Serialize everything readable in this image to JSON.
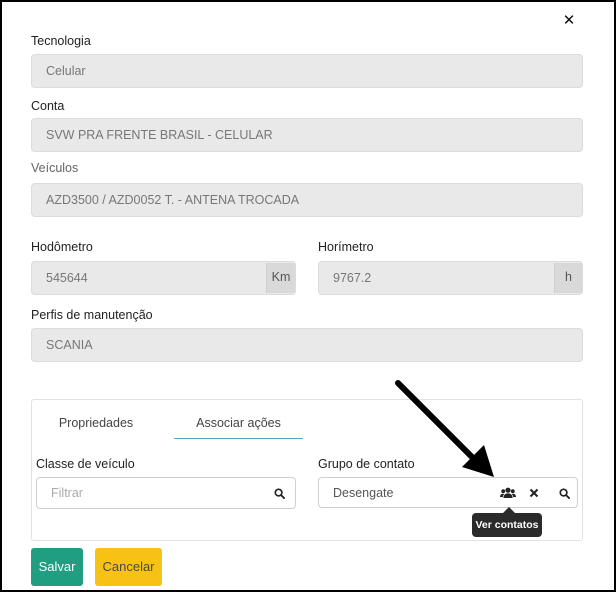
{
  "close": {
    "icon": "close-icon",
    "glyph": "✕"
  },
  "tecnologia": {
    "label": "Tecnologia",
    "value": "Celular"
  },
  "conta": {
    "label": "Conta",
    "value": "SVW PRA FRENTE BRASIL - CELULAR"
  },
  "veiculos": {
    "label": "Veículos",
    "value": "AZD3500 / AZD0052 T. - ANTENA TROCADA"
  },
  "hodometro": {
    "label": "Hodômetro",
    "value": "545644",
    "unit": "Km"
  },
  "horimetro": {
    "label": "Horímetro",
    "value": "9767.2",
    "unit": "h"
  },
  "perfis": {
    "label": "Perfis de manutenção",
    "value": "SCANIA"
  },
  "tabs": [
    {
      "label": "Propriedades",
      "active": false
    },
    {
      "label": "Associar ações",
      "active": true
    }
  ],
  "classe_veiculo": {
    "label": "Classe de veículo",
    "placeholder": "Filtrar",
    "icon": "search-icon"
  },
  "grupo_contato": {
    "label": "Grupo de contato",
    "value": "Desengate",
    "icons": [
      "users-icon",
      "clear-icon",
      "search-icon"
    ]
  },
  "tooltip": {
    "text": "Ver contatos"
  },
  "buttons": {
    "save": "Salvar",
    "cancel": "Cancelar"
  },
  "colors": {
    "save": "#1f9e82",
    "cancel": "#f6c315",
    "tab_active": "#5aa2c8",
    "tooltip": "#2b2b2b"
  }
}
